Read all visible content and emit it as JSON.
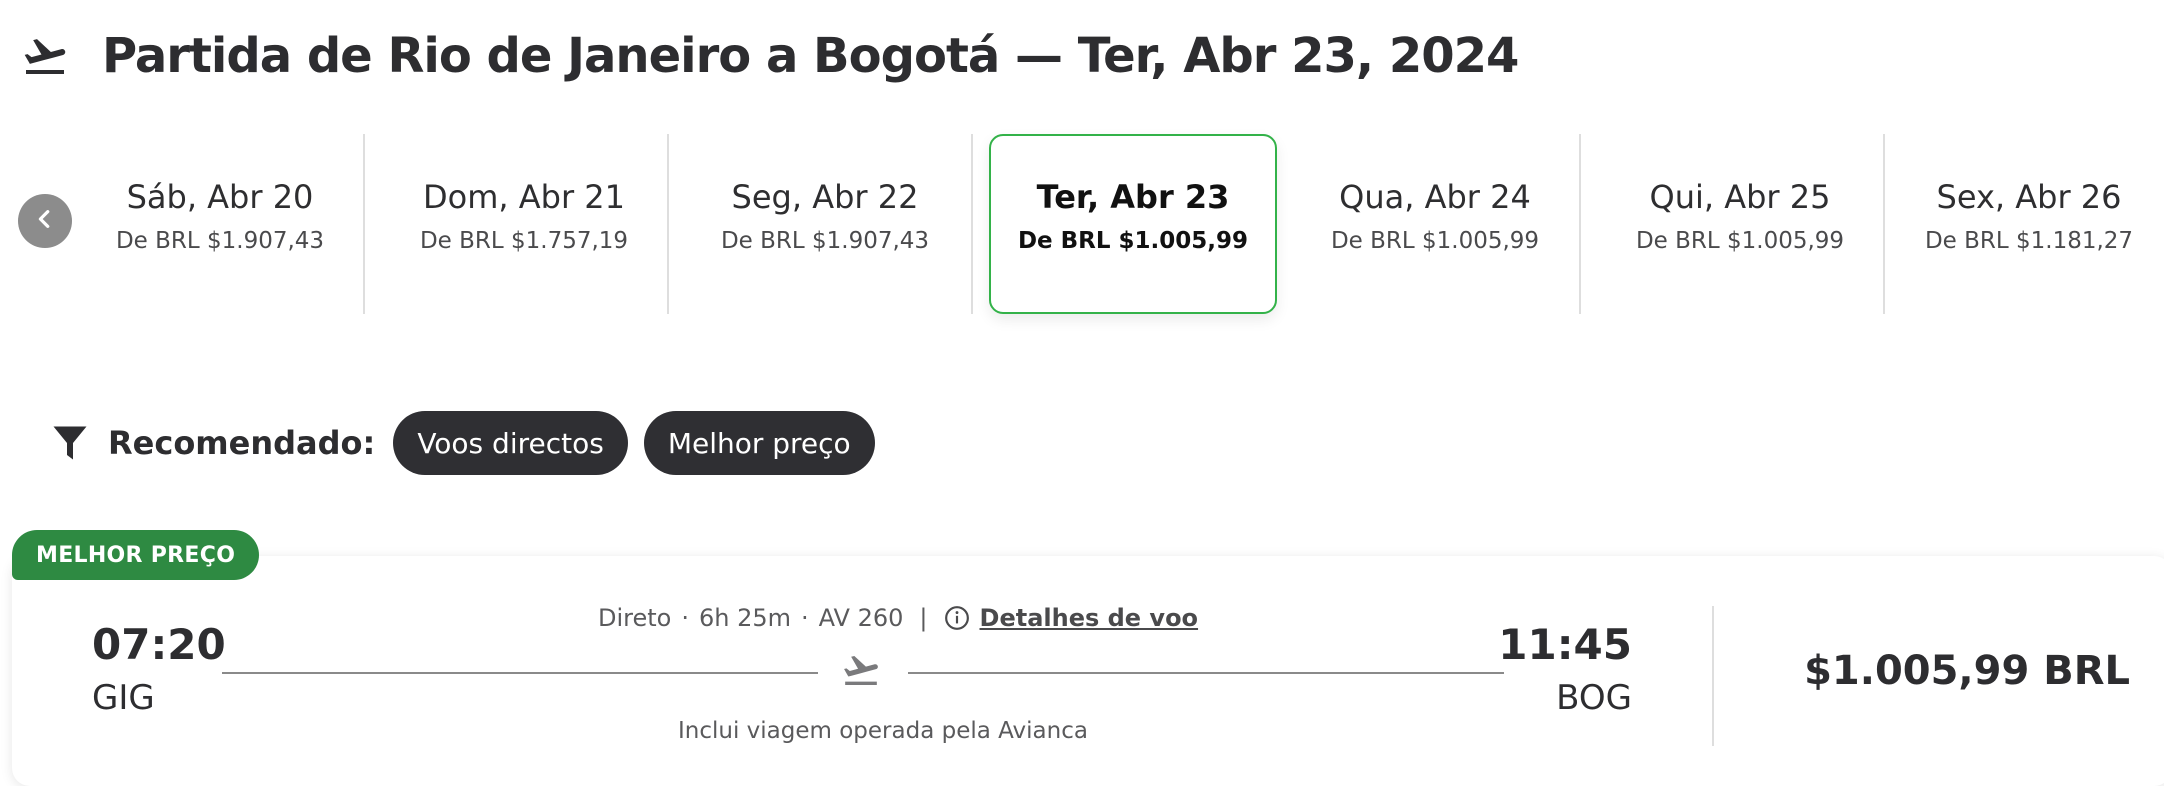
{
  "header": {
    "title": "Partida de Rio de Janeiro a Bogotá — Ter, Abr 23, 2024",
    "icon": "airplane-departure-icon"
  },
  "date_strip": {
    "prev_icon": "chevron-left-icon",
    "dates": [
      {
        "day": "Sáb, Abr 20",
        "price": "De BRL $1.907,43",
        "selected": false
      },
      {
        "day": "Dom, Abr 21",
        "price": "De BRL $1.757,19",
        "selected": false
      },
      {
        "day": "Seg, Abr 22",
        "price": "De BRL $1.907,43",
        "selected": false
      },
      {
        "day": "Ter, Abr 23",
        "price": "De BRL $1.005,99",
        "selected": true
      },
      {
        "day": "Qua, Abr 24",
        "price": "De BRL $1.005,99",
        "selected": false
      },
      {
        "day": "Qui, Abr 25",
        "price": "De BRL $1.005,99",
        "selected": false
      },
      {
        "day": "Sex, Abr 26",
        "price": "De BRL $1.181,27",
        "selected": false
      }
    ],
    "selected_border_color": "#33b249"
  },
  "filters": {
    "icon": "filter-icon",
    "label": "Recomendado:",
    "chips": [
      "Voos directos",
      "Melhor preço"
    ]
  },
  "flight": {
    "badge": "MELHOR PREÇO",
    "badge_color": "#2e8a42",
    "departure_time": "07:20",
    "departure_code": "GIG",
    "arrival_time": "11:45",
    "arrival_code": "BOG",
    "stops": "Direto",
    "duration": "6h 25m",
    "flight_number": "AV 260",
    "details_link": "Detalhes de voo",
    "operated_by": "Inclui viagem operada pela Avianca",
    "price": "$1.005,99 BRL"
  }
}
